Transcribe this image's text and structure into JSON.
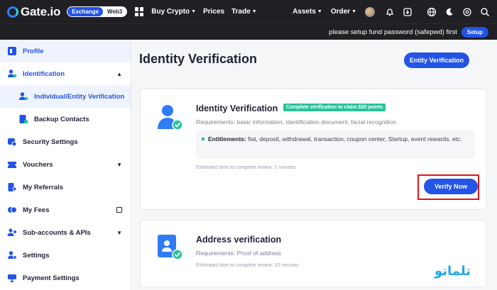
{
  "header": {
    "logo_text": "Gate.io",
    "mode_exchange": "Exchange",
    "mode_web3": "Web3",
    "nav_buy_crypto": "Buy Crypto",
    "nav_prices": "Prices",
    "nav_trade": "Trade",
    "nav_assets": "Assets",
    "nav_order": "Order",
    "icons": [
      "apps-grid-icon",
      "bell-icon",
      "download-icon",
      "globe-icon",
      "moon-icon",
      "settings-icon",
      "search-icon"
    ]
  },
  "notice": {
    "text": "please setup fund password (safepwd) first",
    "button": "Setup"
  },
  "sidebar": {
    "items": [
      {
        "label": "Profile",
        "icon": "profile-icon"
      },
      {
        "label": "Identification",
        "icon": "identification-icon"
      },
      {
        "label": "Individual/Entity Verification",
        "icon": "verified-user-icon"
      },
      {
        "label": "Backup Contacts",
        "icon": "backup-contacts-icon"
      },
      {
        "label": "Security Settings",
        "icon": "security-icon"
      },
      {
        "label": "Vouchers",
        "icon": "voucher-icon"
      },
      {
        "label": "My Referrals",
        "icon": "referrals-icon"
      },
      {
        "label": "My Fees",
        "icon": "fees-icon"
      },
      {
        "label": "Sub-accounts & APIs",
        "icon": "sub-accounts-icon"
      },
      {
        "label": "Settings",
        "icon": "settings-icon"
      },
      {
        "label": "Payment Settings",
        "icon": "payment-icon"
      }
    ]
  },
  "main": {
    "page_title": "Identity Verification",
    "entity_button": "Entity Verification",
    "identity_card": {
      "title": "Identity Verification",
      "badge": "Complete verification to claim $20 points",
      "requirements": "Requirements: basic information, identification document, facial recognition",
      "entitlements_label": "Entitlements:",
      "entitlements_text": "fiat, deposit, withdrawal, transaction, coupon center, Startup, event rewards, etc.",
      "eta": "Estimated time to complete review: 2 minutes",
      "verify_button": "Verify Now"
    },
    "address_card": {
      "title": "Address verification",
      "requirements": "Requirements: Proof of address",
      "eta": "Estimated time to complete review: 10 minutes"
    }
  },
  "watermark": "تلماتو",
  "colors": {
    "accent": "#2354e6",
    "success": "#27c29a",
    "highlight": "#e4131b",
    "topbar": "#1f1f24"
  }
}
